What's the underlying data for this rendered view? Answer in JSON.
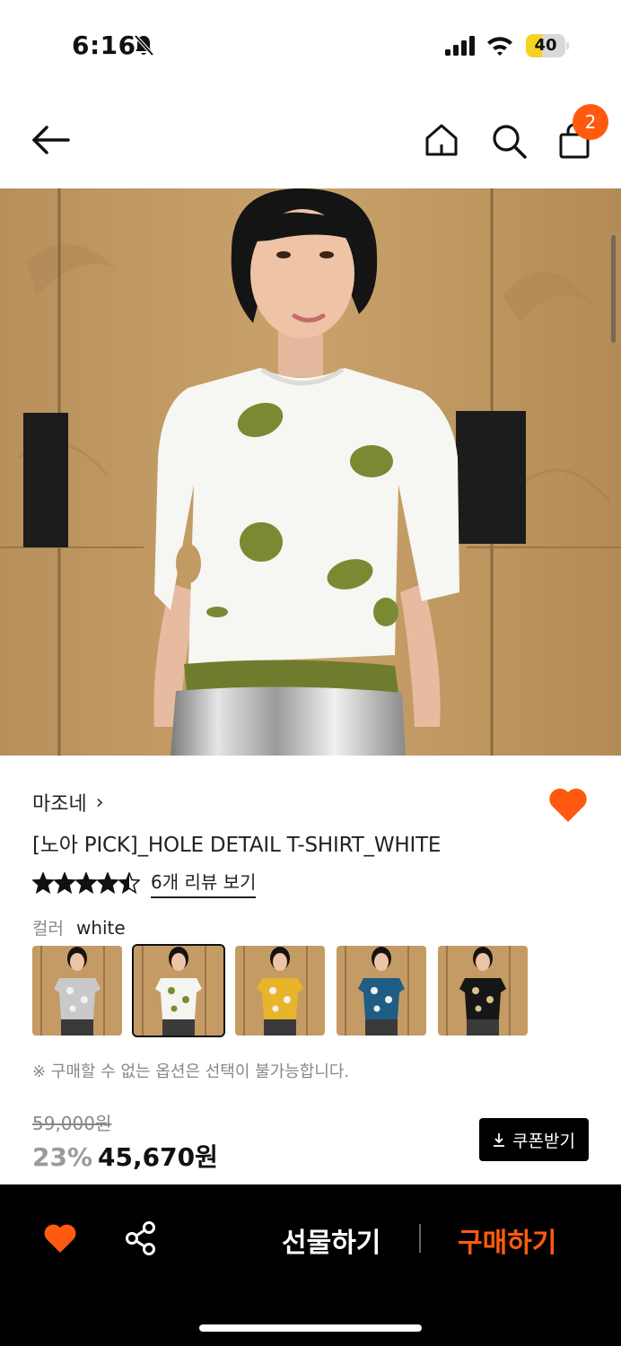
{
  "status_bar": {
    "time": "6:16",
    "battery_level": "40",
    "battery_fraction": 0.4,
    "icons": [
      "bell-off-icon",
      "signal-icon",
      "wifi-icon",
      "battery-icon"
    ]
  },
  "nav": {
    "icons": [
      "back-arrow-icon",
      "home-icon",
      "search-icon",
      "shopping-bag-icon"
    ],
    "cart_count": "2"
  },
  "product": {
    "brand": "마조네",
    "brand_chevron": "›",
    "title": "[노아 PICK]_HOLE DETAIL T-SHIRT_WHITE",
    "rating": 4.5,
    "review_link": "6개 리뷰 보기",
    "color_label": "컬러",
    "color_value": "white",
    "color_options": [
      {
        "name": "gray",
        "swatch": "#c9c9c9",
        "selected": false
      },
      {
        "name": "white",
        "swatch": "#f4f4f0",
        "selected": true
      },
      {
        "name": "yellow",
        "swatch": "#e8b52a",
        "selected": false
      },
      {
        "name": "blue",
        "swatch": "#1f5d85",
        "selected": false
      },
      {
        "name": "black",
        "swatch": "#161616",
        "selected": false
      }
    ],
    "option_note": "※ 구매할 수 없는 옵션은 선택이 불가능합니다.",
    "original_price": "59,000원",
    "discount": "23%",
    "sale_price": "45,670원",
    "coupon_label": "쿠폰받기"
  },
  "bottom_bar": {
    "gift_label": "선물하기",
    "buy_label": "구매하기"
  },
  "colors": {
    "accent": "#ff5a0f",
    "dot_green": "#7a8a33",
    "battery_yellow": "#f5d323"
  }
}
